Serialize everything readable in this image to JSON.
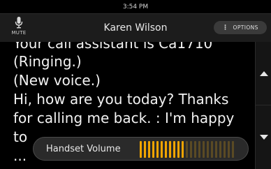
{
  "status_bar": {
    "time": "3:54 PM"
  },
  "header": {
    "mute_label": "MUTE",
    "caller_name": "Karen Wilson",
    "options_label": "OPTIONS"
  },
  "transcript": {
    "lines": [
      "Your call assistant is Ca1710",
      "(Ringing.)",
      "(New voice.)",
      "Hi, how are you today? Thanks",
      "for calling me back. : I'm happy",
      "to",
      "..."
    ]
  },
  "volume": {
    "label": "Handset Volume",
    "level": 11,
    "max": 23,
    "active_color": "#f0a400",
    "inactive_color": "#5a4a24"
  },
  "icons": {
    "mute": "microphone-icon",
    "options": "vertical-dots-icon",
    "scroll_up": "triangle-up-icon",
    "scroll_down": "triangle-down-icon"
  }
}
